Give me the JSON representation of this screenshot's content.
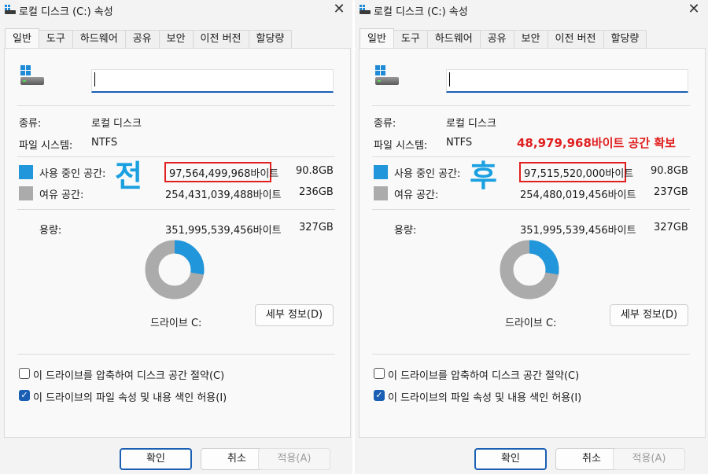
{
  "dialogs": [
    {
      "title": "로컬 디스크 (C:) 속성",
      "close_glyph": "✕",
      "tabs": [
        "일반",
        "도구",
        "하드웨어",
        "공유",
        "보안",
        "이전 버전",
        "할당량"
      ],
      "active_tab": "일반",
      "name_value": "",
      "type_label": "종류:",
      "type_value": "로컬 디스크",
      "fs_label": "파일 시스템:",
      "fs_value": "NTFS",
      "used_label": "사용 중인 공간:",
      "used_bytes": "97,564,499,968바이트",
      "used_size": "90.8GB",
      "free_label": "여유 공간:",
      "free_bytes": "254,431,039,488바이트",
      "free_size": "236GB",
      "capacity_label": "용량:",
      "capacity_bytes": "351,995,539,456바이트",
      "capacity_size": "327GB",
      "used_fraction": 0.277,
      "drive_label": "드라이브 C:",
      "details_button": "세부 정보(D)",
      "compress_label": "이 드라이브를 압축하여 디스크 공간 절약(C)",
      "compress_checked": false,
      "index_label": "이 드라이브의 파일 속성 및 내용 색인 허용(I)",
      "index_checked": true,
      "annotation_big": "전",
      "annotation_note": "",
      "buttons": {
        "ok": "확인",
        "cancel": "취소",
        "apply": "적용(A)"
      }
    },
    {
      "title": "로컬 디스크 (C:) 속성",
      "close_glyph": "✕",
      "tabs": [
        "일반",
        "도구",
        "하드웨어",
        "공유",
        "보안",
        "이전 버전",
        "할당량"
      ],
      "active_tab": "일반",
      "name_value": "",
      "type_label": "종류:",
      "type_value": "로컬 디스크",
      "fs_label": "파일 시스템:",
      "fs_value": "NTFS",
      "used_label": "사용 중인 공간:",
      "used_bytes": "97,515,520,000바이트",
      "used_size": "90.8GB",
      "free_label": "여유 공간:",
      "free_bytes": "254,480,019,456바이트",
      "free_size": "237GB",
      "capacity_label": "용량:",
      "capacity_bytes": "351,995,539,456바이트",
      "capacity_size": "327GB",
      "used_fraction": 0.277,
      "drive_label": "드라이브 C:",
      "details_button": "세부 정보(D)",
      "compress_label": "이 드라이브를 압축하여 디스크 공간 절약(C)",
      "compress_checked": false,
      "index_label": "이 드라이브의 파일 속성 및 내용 색인 허용(I)",
      "index_checked": true,
      "annotation_big": "후",
      "annotation_note": "48,979,968바이트 공간 확보",
      "buttons": {
        "ok": "확인",
        "cancel": "취소",
        "apply": "적용(A)"
      }
    }
  ],
  "colors": {
    "used": "#2196db",
    "free": "#ababab",
    "annotation_blue": "#1aa0e0",
    "annotation_red": "#e02020",
    "accent": "#1a5fb4"
  },
  "icons": {
    "app": "drive-icon",
    "close": "close-icon",
    "checkbox_checked": "checkmark-icon"
  }
}
